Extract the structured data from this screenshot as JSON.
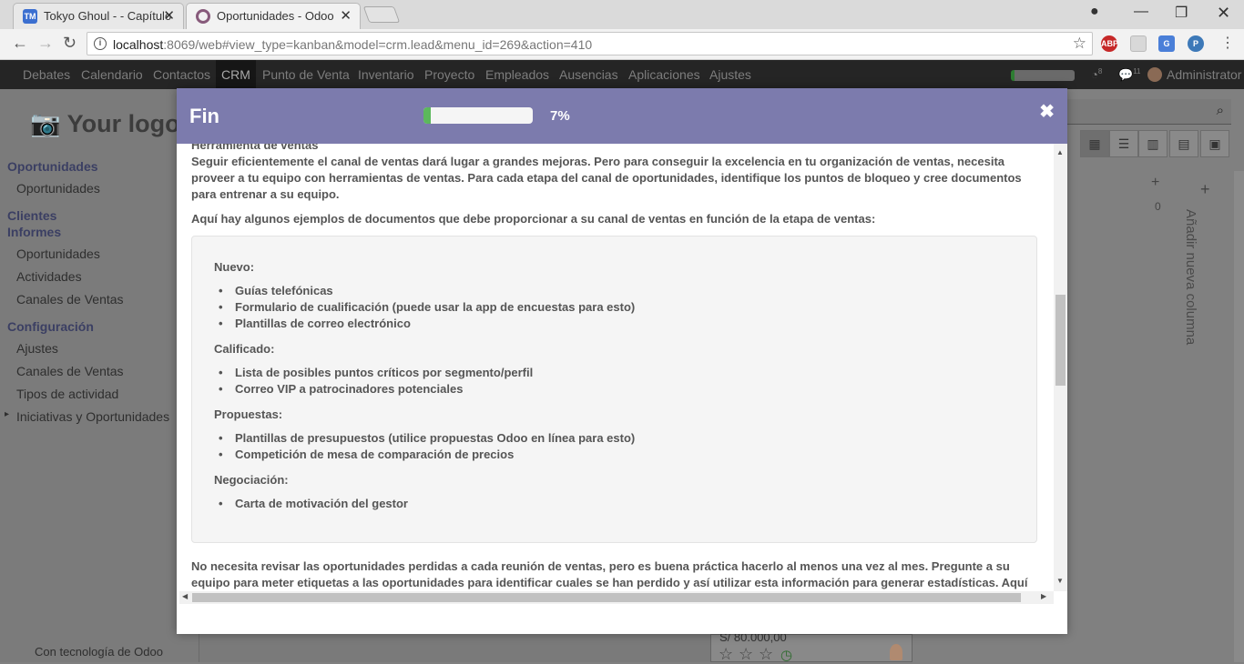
{
  "browser": {
    "tabs": [
      {
        "title": "Tokyo Ghoul - - Capítulo",
        "active": false
      },
      {
        "title": "Oportunidades - Odoo",
        "active": true
      }
    ],
    "url_host": "localhost",
    "url_rest": ":8069/web#view_type=kanban&model=crm.lead&menu_id=269&action=410",
    "extensions": [
      "ABP"
    ]
  },
  "odoo_nav": {
    "menu": [
      "Debates",
      "Calendario",
      "Contactos",
      "CRM",
      "Punto de Venta",
      "Inventario",
      "Proyecto",
      "Empleados",
      "Ausencias",
      "Aplicaciones",
      "Ajustes"
    ],
    "selected": "CRM",
    "badge_1": "8",
    "badge_2": "11",
    "user": "Administrator"
  },
  "sidebar": {
    "logo": "Your logo",
    "sections": [
      {
        "head": "Oportunidades",
        "items": [
          "Oportunidades"
        ]
      },
      {
        "head": "Clientes",
        "items": []
      },
      {
        "head": "Informes",
        "items": [
          "Oportunidades",
          "Actividades",
          "Canales de Ventas"
        ]
      },
      {
        "head": "Configuración",
        "items": [
          "Ajustes",
          "Canales de Ventas",
          "Tipos de actividad",
          "Iniciativas y Oportunidades"
        ]
      }
    ],
    "powered_by": "Con tecnología de Odoo"
  },
  "background": {
    "add_column": "Añadir nueva columna",
    "column_count": "0",
    "card_price": "S/ 80.000,00"
  },
  "modal": {
    "title": "Fin",
    "progress": 0.07,
    "progress_label": "7%",
    "section_title": "Herramienta de ventas",
    "intro": "Seguir eficientemente el canal de ventas dará lugar a grandes mejoras. Pero para conseguir la excelencia en tu organización de ventas, necesita proveer a tu equipo con herramientas de ventas. Para cada etapa del canal de oportunidades, identifique los puntos de bloqueo y cree documentos para entrenar a su equipo.",
    "examples_lead": "Aquí hay algunos ejemplos de documentos que debe proporcionar a su canal de ventas en función de la etapa de ventas:",
    "stages": [
      {
        "name": "Nuevo:",
        "items": [
          "Guías telefónicas",
          "Formulario de cualificación (puede usar la app de encuestas para esto)",
          "Plantillas de correo electrónico"
        ]
      },
      {
        "name": "Calificado:",
        "items": [
          "Lista de posibles puntos críticos por segmento/perfil",
          "Correo VIP a patrocinadores potenciales"
        ]
      },
      {
        "name": "Propuestas:",
        "items": [
          "Plantillas de presupuestos (utilice propuestas Odoo en línea para esto)",
          "Competición de mesa de comparación de precios"
        ]
      },
      {
        "name": "Negociación:",
        "items": [
          "Carta de motivación del gestor"
        ]
      }
    ],
    "footer_line1": "No necesita revisar las oportunidades perdidas a cada reunión de ventas, pero es buena práctica hacerlo al menos una vez al mes. Pregunte a su",
    "footer_line2": "equipo para meter etiquetas a las oportunidades para identificar cuales se han perdido y así utilizar esta información para generar estadísticas. Aquí"
  }
}
